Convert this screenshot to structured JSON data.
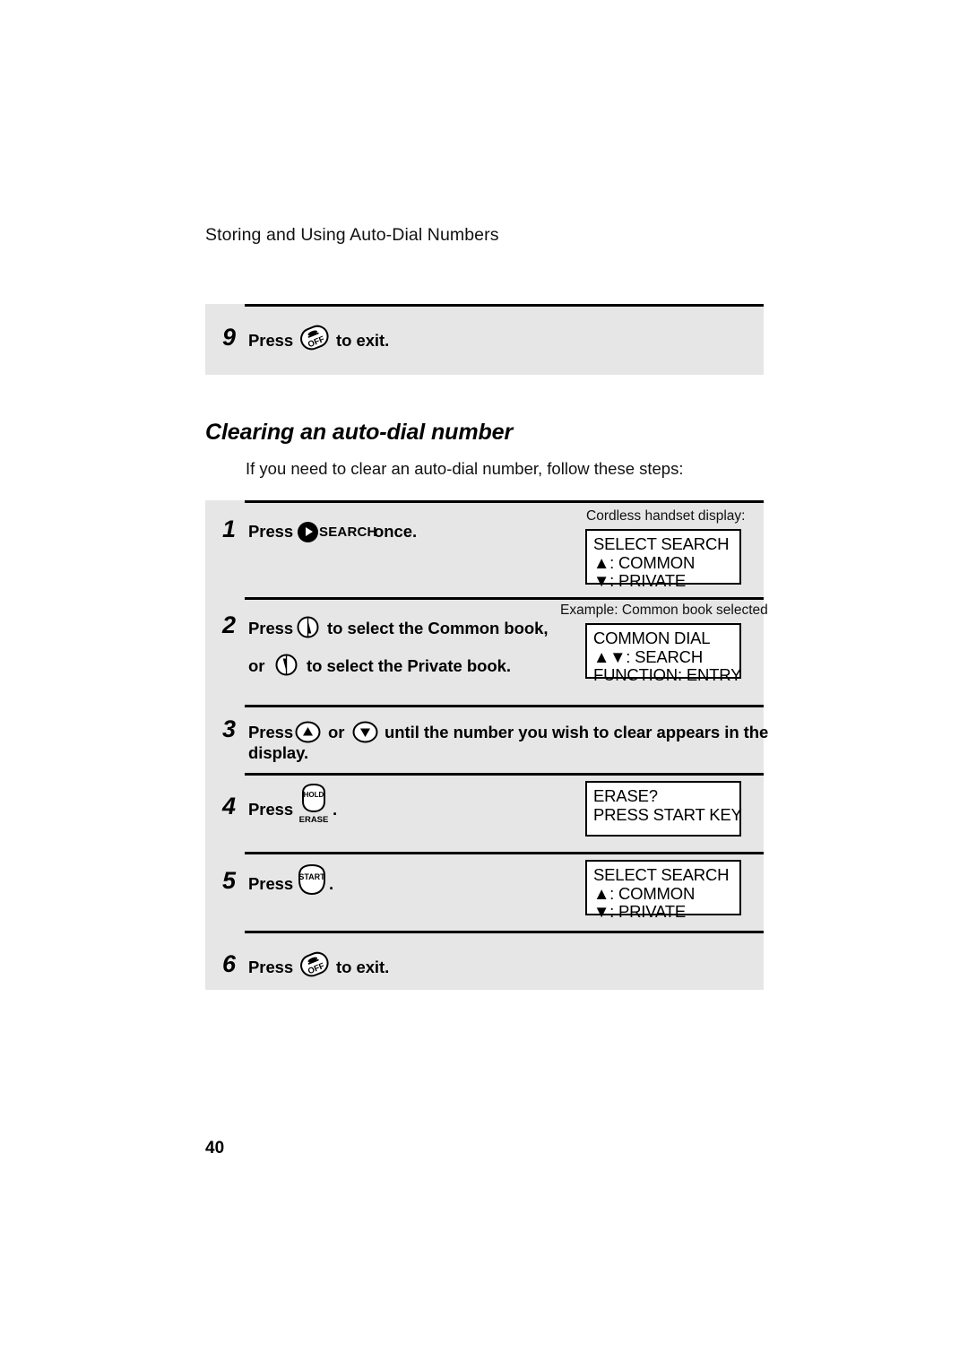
{
  "page": {
    "running_header": "Storing and Using Auto-Dial Numbers",
    "folio": "40"
  },
  "top_step": {
    "number": "9",
    "press_label": "Press",
    "key": "off-key",
    "tail_label": "to exit."
  },
  "section": {
    "heading": "Clearing an auto-dial number",
    "intro": "If you need to clear an auto-dial number, follow these steps:"
  },
  "steps": [
    {
      "number": "1",
      "press_label": "Press",
      "key": "search-key",
      "key_word": "SEARCH",
      "tail_label": "once.",
      "caption": "Cordless handset display:",
      "display": [
        "SELECT SEARCH",
        "▲: COMMON",
        "▼: PRIVATE"
      ]
    },
    {
      "number": "2",
      "press_label": "Press",
      "key": "rocker-up-key",
      "tail_label": "to select the Common book,",
      "or_label": "or",
      "key2": "rocker-down-key",
      "tail_label2": "to select the Private book.",
      "caption": "Example: Common book selected",
      "display": [
        "COMMON DIAL",
        "▲▼: SEARCH",
        "FUNCTION: ENTRY"
      ]
    },
    {
      "number": "3",
      "press_label": "Press",
      "key": "oval-up-key",
      "or_label": "or",
      "key2": "oval-down-key",
      "tail_label": "until the number you wish to clear appears in the",
      "tail_label2": "display.",
      "caption": "",
      "display": []
    },
    {
      "number": "4",
      "press_label": "Press",
      "key": "hold-erase-key",
      "key_word_top": "HOLD",
      "key_word_bottom": "ERASE",
      "tail_label": ".",
      "caption": "",
      "display": [
        "ERASE?",
        "PRESS START KEY"
      ]
    },
    {
      "number": "5",
      "press_label": "Press",
      "key": "start-key",
      "key_word": "START",
      "tail_label": ".",
      "caption": "",
      "display": [
        "SELECT SEARCH",
        "▲: COMMON",
        "▼: PRIVATE"
      ]
    },
    {
      "number": "6",
      "press_label": "Press",
      "key": "off-key",
      "tail_label": "to exit.",
      "caption": "",
      "display": []
    }
  ],
  "colors": {
    "panel_background": "#e6e6e6",
    "ink": "#000000",
    "paper": "#ffffff"
  }
}
